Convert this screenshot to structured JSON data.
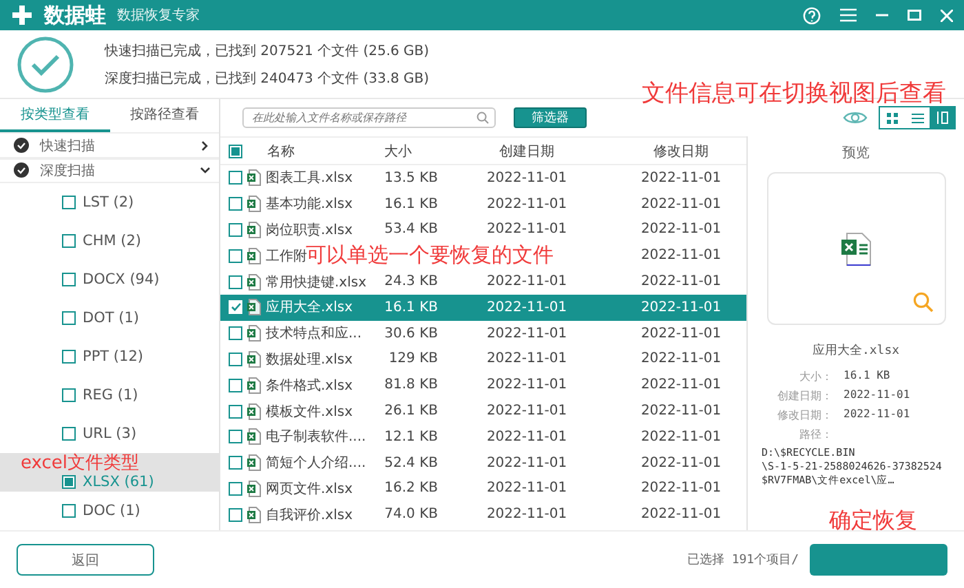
{
  "title_bar": {
    "logo_text": "数据蛙",
    "subtitle": "数据恢复专家"
  },
  "scan_summary": [
    "快速扫描已完成，已找到 207521 个文件 (25.6 GB)",
    "深度扫描已完成，已找到 240473 个文件 (33.8 GB)"
  ],
  "tabs": [
    {
      "label": "按类型查看",
      "selected": true
    },
    {
      "label": "按路径查看",
      "selected": false
    }
  ],
  "search": {
    "placeholder": "在此处输入文件名称或保存路径"
  },
  "filter_button": "筛选器",
  "view_modes": [
    {
      "kind": "grid",
      "selected": false
    },
    {
      "kind": "list",
      "selected": false
    },
    {
      "kind": "detail",
      "selected": true
    }
  ],
  "sidebar": {
    "groups": [
      {
        "label": "快速扫描",
        "expanded": false
      },
      {
        "label": "深度扫描",
        "expanded": true,
        "children": [
          {
            "label": "LST (2)",
            "checked": false,
            "selected": false
          },
          {
            "label": "CHM (2)",
            "checked": false,
            "selected": false
          },
          {
            "label": "DOCX (94)",
            "checked": false,
            "selected": false
          },
          {
            "label": "DOT (1)",
            "checked": false,
            "selected": false
          },
          {
            "label": "PPT (12)",
            "checked": false,
            "selected": false
          },
          {
            "label": "REG (1)",
            "checked": false,
            "selected": false
          },
          {
            "label": "URL (3)",
            "checked": false,
            "selected": false
          },
          {
            "label": "XLSX (61)",
            "checked": true,
            "selected": true,
            "annotation": "excel文件类型"
          },
          {
            "label": "DOC (1)",
            "checked": false,
            "selected": false
          }
        ]
      }
    ]
  },
  "table": {
    "select_all_checked": true,
    "columns": [
      "名称",
      "大小",
      "创建日期",
      "修改日期"
    ],
    "rows": [
      {
        "name": "图表工具.xlsx",
        "size": "13.5 KB",
        "created": "2022-11-01",
        "modified": "2022-11-01",
        "selected": false
      },
      {
        "name": "基本功能.xlsx",
        "size": "16.1 KB",
        "created": "2022-11-01",
        "modified": "2022-11-01",
        "selected": false
      },
      {
        "name": "岗位职责.xlsx",
        "size": "53.4 KB",
        "created": "2022-11-01",
        "modified": "2022-11-01",
        "selected": false
      },
      {
        "name": "工作附",
        "modified": "2022-11-01",
        "selected": false,
        "annotation": "可以单选一个要恢复的文件"
      },
      {
        "name": "常用快捷键.xlsx",
        "size": "24.3 KB",
        "created": "2022-11-01",
        "modified": "2022-11-01",
        "selected": false
      },
      {
        "name": "应用大全.xlsx",
        "size": "16.1 KB",
        "created": "2022-11-01",
        "modified": "2022-11-01",
        "selected": true
      },
      {
        "name": "技术特点和应...",
        "size": "30.6 KB",
        "created": "2022-11-01",
        "modified": "2022-11-01",
        "selected": false
      },
      {
        "name": "数据处理.xlsx",
        "size": "129 KB",
        "created": "2022-11-01",
        "modified": "2022-11-01",
        "selected": false
      },
      {
        "name": "条件格式.xlsx",
        "size": "81.8 KB",
        "created": "2022-11-01",
        "modified": "2022-11-01",
        "selected": false
      },
      {
        "name": "模板文件.xlsx",
        "size": "26.1 KB",
        "created": "2022-11-01",
        "modified": "2022-11-01",
        "selected": false
      },
      {
        "name": "电子制表软件....",
        "size": "12.1 KB",
        "created": "2022-11-01",
        "modified": "2022-11-01",
        "selected": false
      },
      {
        "name": "简短个人介绍....",
        "size": "52.4 KB",
        "created": "2022-11-01",
        "modified": "2022-11-01",
        "selected": false
      },
      {
        "name": "网页文件.xlsx",
        "size": "16.2 KB",
        "created": "2022-11-01",
        "modified": "2022-11-01",
        "selected": false
      },
      {
        "name": "自我评价.xlsx",
        "size": "74.0 KB",
        "created": "2022-11-01",
        "modified": "2022-11-01",
        "selected": false
      }
    ]
  },
  "preview": {
    "title": "预览",
    "filename": "应用大全.xlsx",
    "details": [
      {
        "label": "大小：",
        "value": "16.1 KB"
      },
      {
        "label": "创建日期：",
        "value": "2022-11-01"
      },
      {
        "label": "修改日期：",
        "value": "2022-11-01"
      },
      {
        "label": "路径："
      }
    ],
    "path_lines": [
      "D:\\$RECYCLE.BIN",
      "\\S-1-5-21-2588024626-37382524",
      "$RV7FMAB\\文件excel\\应…"
    ]
  },
  "footer": {
    "back_button": "返回",
    "status": "已选择 191个项目/"
  },
  "annotations": [
    "文件信息可在切换视图后查看",
    "确定恢复"
  ]
}
